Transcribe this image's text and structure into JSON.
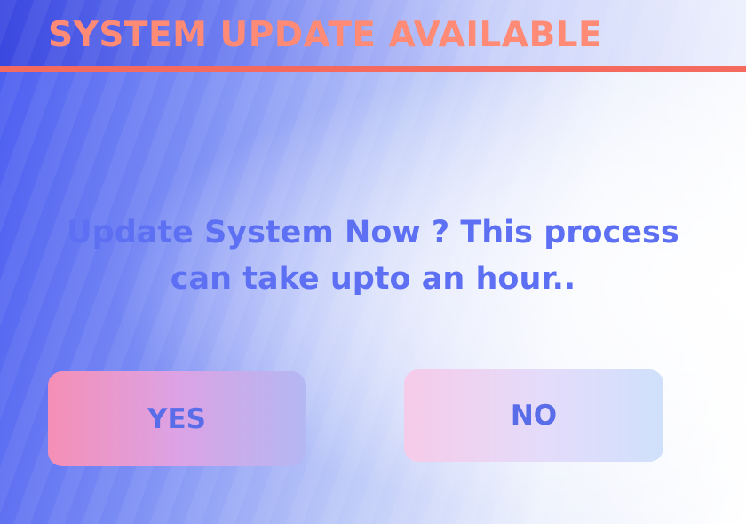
{
  "dialog": {
    "title": "SYSTEM UPDATE AVAILABLE",
    "message_line1": "Update System Now ? This process",
    "message_line2": "can take upto an hour..",
    "yes_label": "YES",
    "no_label": "NO"
  },
  "colors": {
    "title": "#ff8a75",
    "divider": "#f56a5e",
    "message": "#5d6ff2",
    "button_text": "#5a6de8"
  }
}
